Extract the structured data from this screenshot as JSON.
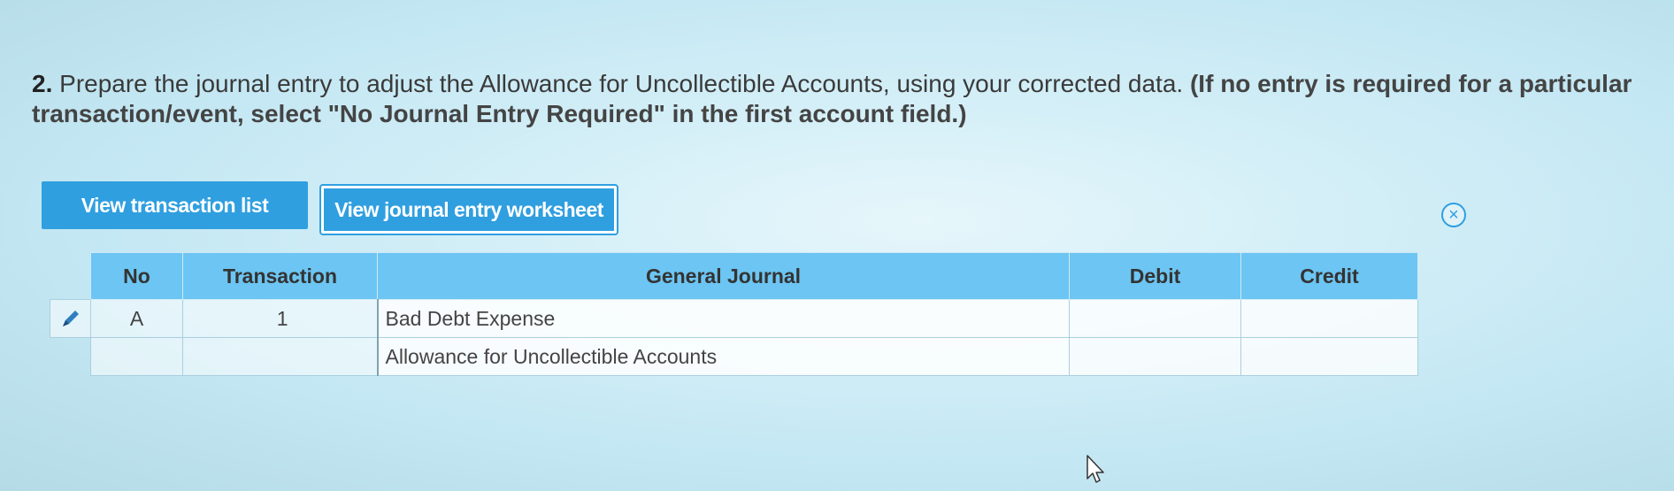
{
  "question": {
    "number": "2.",
    "text": "Prepare the journal entry to adjust the Allowance for Uncollectible Accounts, using your corrected data.",
    "instruction": "(If no entry is required for a particular transaction/event, select \"No Journal Entry Required\" in the first account field.)"
  },
  "buttons": {
    "view_transactions": "View transaction list",
    "view_worksheet": "View journal entry worksheet",
    "close_symbol": "×"
  },
  "table": {
    "headers": {
      "no": "No",
      "transaction": "Transaction",
      "general_journal": "General Journal",
      "debit": "Debit",
      "credit": "Credit"
    },
    "rows": [
      {
        "no": "A",
        "transaction": "1",
        "account": "Bad Debt Expense",
        "debit": "",
        "credit": ""
      },
      {
        "no": "",
        "transaction": "",
        "account": "Allowance for Uncollectible Accounts",
        "debit": "",
        "credit": ""
      }
    ]
  },
  "icons": {
    "edit": "pencil-icon",
    "close": "close-circle-icon",
    "pointer": "mouse-cursor-icon"
  },
  "colors": {
    "accent": "#2f9fe0",
    "header_bg": "#6cc5f2"
  }
}
